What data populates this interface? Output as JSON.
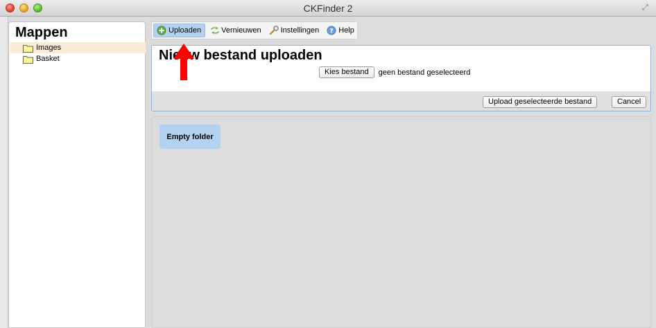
{
  "window": {
    "title": "CKFinder 2"
  },
  "folders": {
    "heading": "Mappen",
    "items": [
      {
        "label": "Images",
        "selected": true
      },
      {
        "label": "Basket",
        "selected": false
      }
    ]
  },
  "toolbar": {
    "buttons": [
      {
        "label": "Uploaden",
        "icon": "upload-plus-icon",
        "active": true
      },
      {
        "label": "Vernieuwen",
        "icon": "refresh-arrows-icon",
        "active": false
      },
      {
        "label": "Instellingen",
        "icon": "wrench-icon",
        "active": false
      },
      {
        "label": "Help",
        "icon": "help-icon",
        "active": false
      }
    ]
  },
  "upload": {
    "title": "Nieuw bestand uploaden",
    "choose_file_label": "Kies bestand",
    "file_status": "geen bestand geselecteerd",
    "submit_label": "Upload geselecteerde bestand",
    "cancel_label": "Cancel"
  },
  "files": {
    "empty_label": "Empty folder"
  },
  "colors": {
    "accent_selected": "#b3d2f2",
    "folder_selected_bg": "#fbebd8",
    "annotation_arrow": "#ff0000"
  }
}
